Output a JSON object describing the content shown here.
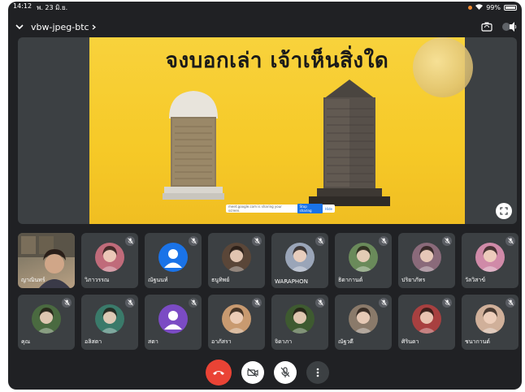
{
  "status": {
    "time": "14:12",
    "date": "พ. 23 มิ.ย.",
    "battery": "99%"
  },
  "meeting": {
    "code": "vbw-jpeg-btc"
  },
  "slide": {
    "title": "จงบอกเล่า เจ้าเห็นสิ่งใด",
    "share_banner_text": "meet.google.com is sharing your screen.",
    "stop_label": "Stop sharing",
    "hide_label": "Hide"
  },
  "participants": [
    {
      "name": "ญาณินทร์",
      "video": true,
      "muted": false,
      "avatar_bg": "#7a6a55"
    },
    {
      "name": "วิภาวรรณ",
      "video": false,
      "muted": true,
      "avatar_bg": "#c06b7a"
    },
    {
      "name": "ณัฐนนท์",
      "video": false,
      "muted": true,
      "avatar_bg": "#1a73e8",
      "default_avatar": true
    },
    {
      "name": "ธนูทิพย์",
      "video": false,
      "muted": true,
      "avatar_bg": "#5a4638"
    },
    {
      "name": "WARAPHON",
      "video": false,
      "muted": true,
      "avatar_bg": "#9aa5b8"
    },
    {
      "name": "ธิดากานต์",
      "video": false,
      "muted": true,
      "avatar_bg": "#6a8a5a"
    },
    {
      "name": "ปริยาภัทร",
      "video": false,
      "muted": true,
      "avatar_bg": "#8a6a7a"
    },
    {
      "name": "วัลวิสาข์",
      "video": false,
      "muted": true,
      "avatar_bg": "#d08aa8"
    },
    {
      "name": "คุณ",
      "video": false,
      "muted": true,
      "avatar_bg": "#4a6a40"
    },
    {
      "name": "อลิสตา",
      "video": false,
      "muted": true,
      "avatar_bg": "#3a7a6a"
    },
    {
      "name": "สตา",
      "video": false,
      "muted": false,
      "avatar_bg": "#7b4bc4",
      "default_avatar": true
    },
    {
      "name": "อาภัสรา",
      "video": false,
      "muted": true,
      "avatar_bg": "#c89a70"
    },
    {
      "name": "จิดาภา",
      "video": false,
      "muted": true,
      "avatar_bg": "#3e5a30"
    },
    {
      "name": "ณัฐวดี",
      "video": false,
      "muted": true,
      "avatar_bg": "#8a7a6a"
    },
    {
      "name": "ศิรินดา",
      "video": false,
      "muted": true,
      "avatar_bg": "#a84040"
    },
    {
      "name": "ชนากานต์",
      "video": false,
      "muted": true,
      "avatar_bg": "#d0b09a"
    }
  ],
  "colors": {
    "background": "#202124",
    "tile": "#3c4043",
    "end_call": "#ea4335",
    "slide_yellow": "#f6c927"
  },
  "icons": {
    "back": "chevron-down-icon",
    "switch_camera": "camera-switch-icon",
    "audio": "speaker-icon",
    "fullscreen": "fullscreen-icon",
    "end_call": "phone-hangup-icon",
    "camera": "camera-off-icon",
    "mic": "mic-off-icon",
    "more": "more-vert-icon"
  }
}
